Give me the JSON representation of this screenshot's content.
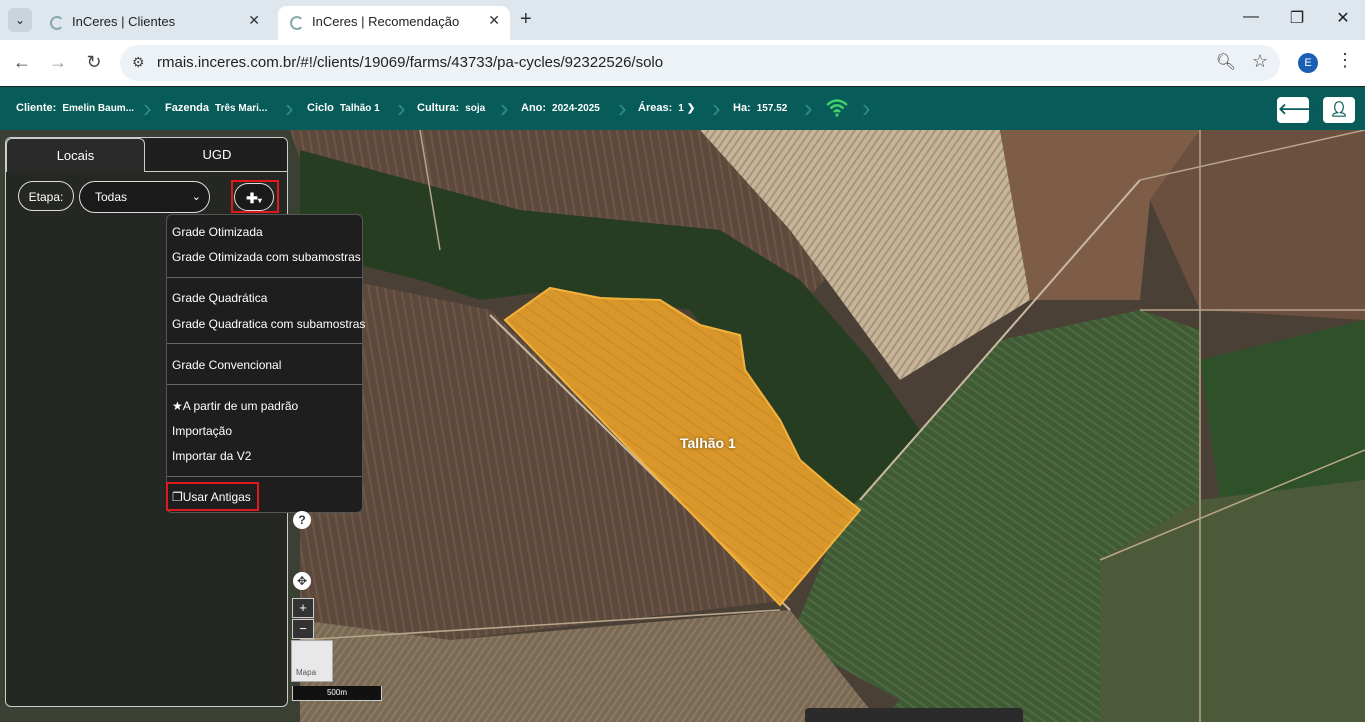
{
  "browser": {
    "tabs": [
      {
        "title": "InCeres | Clientes",
        "active": false
      },
      {
        "title": "InCeres | Recomendação",
        "active": true
      }
    ],
    "url": "rmais.inceres.com.br/#!/clients/19069/farms/43733/pa-cycles/92322526/solo",
    "profile_initial": "E"
  },
  "header": {
    "cliente_label": "Cliente:",
    "cliente_value": "Emelin Baum...",
    "fazenda_label": "Fazenda",
    "fazenda_value": "Três Mari...",
    "ciclo_label": "Ciclo",
    "ciclo_value": "Talhão 1",
    "cultura_label": "Cultura:",
    "cultura_value": "soja",
    "ano_label": "Ano:",
    "ano_value": "2024-2025",
    "areas_label": "Áreas:",
    "areas_value": "1",
    "ha_label": "Ha:",
    "ha_value": "157.52",
    "accent_color": "#075b58"
  },
  "panel": {
    "tabs": [
      "Locais",
      "UGD"
    ],
    "etapa_label": "Etapa:",
    "etapa_value": "Todas"
  },
  "dropdown": {
    "groups": [
      [
        "Grade Otimizada",
        "Grade Otimizada com subamostras"
      ],
      [
        "Grade Quadrática",
        "Grade Quadratica com subamostras"
      ],
      [
        "Grade Convencional"
      ],
      [
        "A partir de um padrão",
        "Importação",
        "Importar da V2"
      ],
      [
        "Usar Antigas"
      ]
    ]
  },
  "map": {
    "field_label": "Talhão 1",
    "field_color": "#f0a020",
    "basemap_label": "Mapa",
    "scale_label": "500m"
  }
}
